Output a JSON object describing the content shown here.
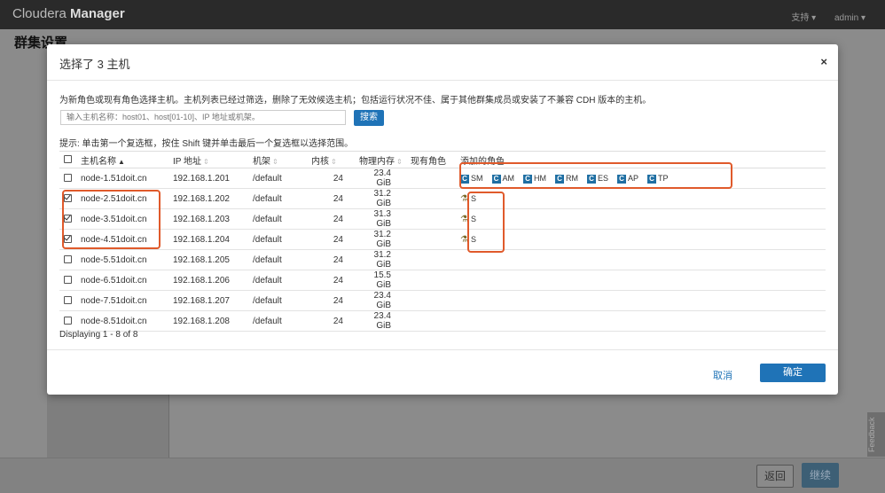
{
  "app": {
    "brand_light": "Cloudera ",
    "brand_bold": "Manager",
    "support": "支持 ▾",
    "user": "admin ▾"
  },
  "page": {
    "title": "群集设置",
    "back": "返回",
    "continue": "继续",
    "feedback": "Feedback"
  },
  "modal": {
    "title": "选择了 3 主机",
    "close": "×",
    "description": "为新角色或现有角色选择主机。主机列表已经过筛选，删除了无效候选主机；包括运行状况不佳、属于其他群集成员或安装了不兼容 CDH 版本的主机。",
    "search_placeholder": "输入主机名称：host01、host[01-10]、IP 地址或机架。",
    "search_button": "搜索",
    "hint": "提示: 单击第一个复选框，按住 Shift 键并单击最后一个复选框以选择范围。",
    "columns": {
      "hostname": "主机名称",
      "ip": "IP 地址",
      "rack": "机架",
      "cores": "内核",
      "memory": "物理内存",
      "existing_roles": "现有角色",
      "added_roles": "添加的角色"
    },
    "sort_up": "▲",
    "sort_both": "⇕",
    "rows": [
      {
        "hostname": "node-1.51doit.cn",
        "ip": "192.168.1.201",
        "rack": "/default",
        "cores": "24",
        "memory": "23.4 GiB",
        "checked": false
      },
      {
        "hostname": "node-2.51doit.cn",
        "ip": "192.168.1.202",
        "rack": "/default",
        "cores": "24",
        "memory": "31.2 GiB",
        "checked": true
      },
      {
        "hostname": "node-3.51doit.cn",
        "ip": "192.168.1.203",
        "rack": "/default",
        "cores": "24",
        "memory": "31.3 GiB",
        "checked": true
      },
      {
        "hostname": "node-4.51doit.cn",
        "ip": "192.168.1.204",
        "rack": "/default",
        "cores": "24",
        "memory": "31.2 GiB",
        "checked": true
      },
      {
        "hostname": "node-5.51doit.cn",
        "ip": "192.168.1.205",
        "rack": "/default",
        "cores": "24",
        "memory": "31.2 GiB",
        "checked": false
      },
      {
        "hostname": "node-6.51doit.cn",
        "ip": "192.168.1.206",
        "rack": "/default",
        "cores": "24",
        "memory": "15.5 GiB",
        "checked": false
      },
      {
        "hostname": "node-7.51doit.cn",
        "ip": "192.168.1.207",
        "rack": "/default",
        "cores": "24",
        "memory": "23.4 GiB",
        "checked": false
      },
      {
        "hostname": "node-8.51doit.cn",
        "ip": "192.168.1.208",
        "rack": "/default",
        "cores": "24",
        "memory": "23.4 GiB",
        "checked": false
      }
    ],
    "row1_roles": [
      {
        "icon": "C",
        "label": "SM"
      },
      {
        "icon": "C",
        "label": "AM"
      },
      {
        "icon": "C",
        "label": "HM"
      },
      {
        "icon": "C",
        "label": "RM"
      },
      {
        "icon": "C",
        "label": "ES"
      },
      {
        "icon": "C",
        "label": "AP"
      },
      {
        "icon": "C",
        "label": "TP"
      }
    ],
    "server_role": {
      "label": "S"
    },
    "displaying": "Displaying 1 - 8 of 8",
    "cancel": "取消",
    "ok": "确定"
  },
  "colors": {
    "accent": "#1f73b7",
    "highlight": "#e05a2b"
  }
}
